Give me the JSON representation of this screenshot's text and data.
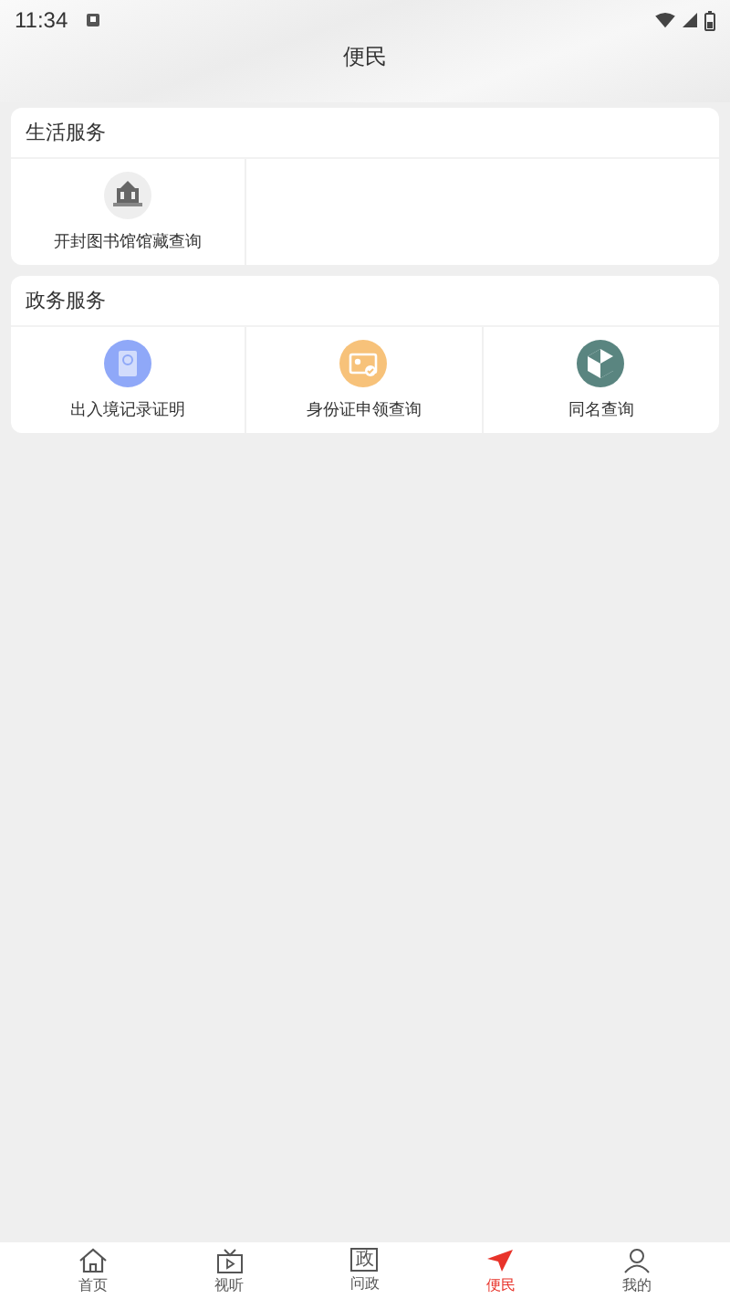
{
  "status_bar": {
    "time": "11:34"
  },
  "header": {
    "title": "便民"
  },
  "sections": [
    {
      "title": "生活服务",
      "items": [
        {
          "label": "开封图书馆馆藏查询",
          "kind": "library",
          "color": "#eeeeee"
        }
      ]
    },
    {
      "title": "政务服务",
      "items": [
        {
          "label": "出入境记录证明",
          "kind": "passport",
          "color": "#8fa8f8"
        },
        {
          "label": "身份证申领查询",
          "kind": "id-card",
          "color": "#f7c27a"
        },
        {
          "label": "同名查询",
          "kind": "shield",
          "color": "#5a8580"
        }
      ]
    }
  ],
  "nav": [
    {
      "label": "首页",
      "kind": "home",
      "selected": false
    },
    {
      "label": "视听",
      "kind": "tv",
      "selected": false
    },
    {
      "label": "问政",
      "kind": "glyph",
      "glyph": "政",
      "selected": false
    },
    {
      "label": "便民",
      "kind": "plane",
      "selected": true
    },
    {
      "label": "我的",
      "kind": "person",
      "selected": false
    }
  ]
}
